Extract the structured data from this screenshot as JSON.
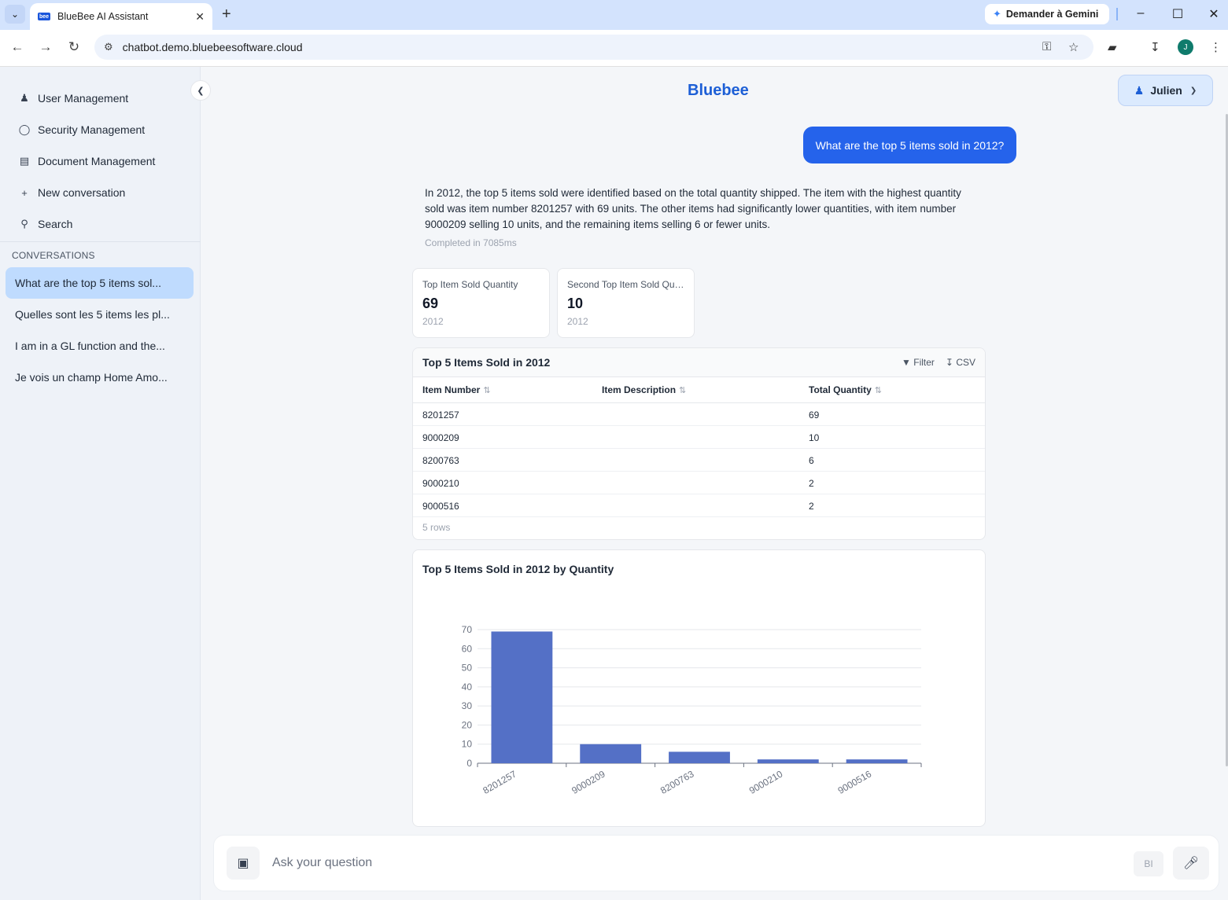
{
  "browser": {
    "tab_title": "BlueBee AI Assistant",
    "favicon_text": "bee",
    "gemini_label": "Demander à Gemini",
    "url": "chatbot.demo.bluebeesoftware.cloud",
    "profile_initial": "J"
  },
  "sidebar": {
    "nav": [
      {
        "label": "User Management",
        "icon": "users-icon"
      },
      {
        "label": "Security Management",
        "icon": "shield-icon"
      },
      {
        "label": "Document Management",
        "icon": "document-icon"
      },
      {
        "label": "New conversation",
        "icon": "plus-icon"
      },
      {
        "label": "Search",
        "icon": "search-icon"
      }
    ],
    "conversations_heading": "CONVERSATIONS",
    "conversations": [
      "What are the top 5 items sol...",
      "Quelles sont les 5 items les pl...",
      "I am in a GL function and the...",
      "Je vois un champ Home Amo..."
    ]
  },
  "header": {
    "brand": "Bluebee",
    "user_name": "Julien"
  },
  "chat": {
    "user_message": "What are the top 5 items sold in 2012?",
    "answer": "In 2012, the top 5 items sold were identified based on the total quantity shipped. The item with the highest quantity sold was item number 8201257 with 69 units. The other items had significantly lower quantities, with item number 9000209 selling 10 units, and the remaining items selling 6 or fewer units.",
    "completed": "Completed in 7085ms"
  },
  "kpis": [
    {
      "label": "Top Item Sold Quantity",
      "value": "69",
      "sub": "2012"
    },
    {
      "label": "Second Top Item Sold Qua...",
      "value": "10",
      "sub": "2012"
    }
  ],
  "table": {
    "title": "Top 5 Items Sold in 2012",
    "filter_label": "Filter",
    "csv_label": "CSV",
    "columns": [
      "Item Number",
      "Item Description",
      "Total Quantity"
    ],
    "rows": [
      [
        "8201257",
        "",
        "69"
      ],
      [
        "9000209",
        "",
        "10"
      ],
      [
        "8200763",
        "",
        "6"
      ],
      [
        "9000210",
        "",
        "2"
      ],
      [
        "9000516",
        "",
        "2"
      ]
    ],
    "footer": "5 rows"
  },
  "chart_data": {
    "type": "bar",
    "title": "Top 5 Items Sold in 2012 by Quantity",
    "categories": [
      "8201257",
      "9000209",
      "8200763",
      "9000210",
      "9000516"
    ],
    "values": [
      69,
      10,
      6,
      2,
      2
    ],
    "ylim": [
      0,
      70
    ],
    "yticks": [
      0,
      10,
      20,
      30,
      40,
      50,
      60,
      70
    ],
    "xlabel": "",
    "ylabel": "",
    "color": "#5470c6",
    "grid": true
  },
  "input": {
    "placeholder": "Ask your question",
    "bi_label": "BI"
  }
}
